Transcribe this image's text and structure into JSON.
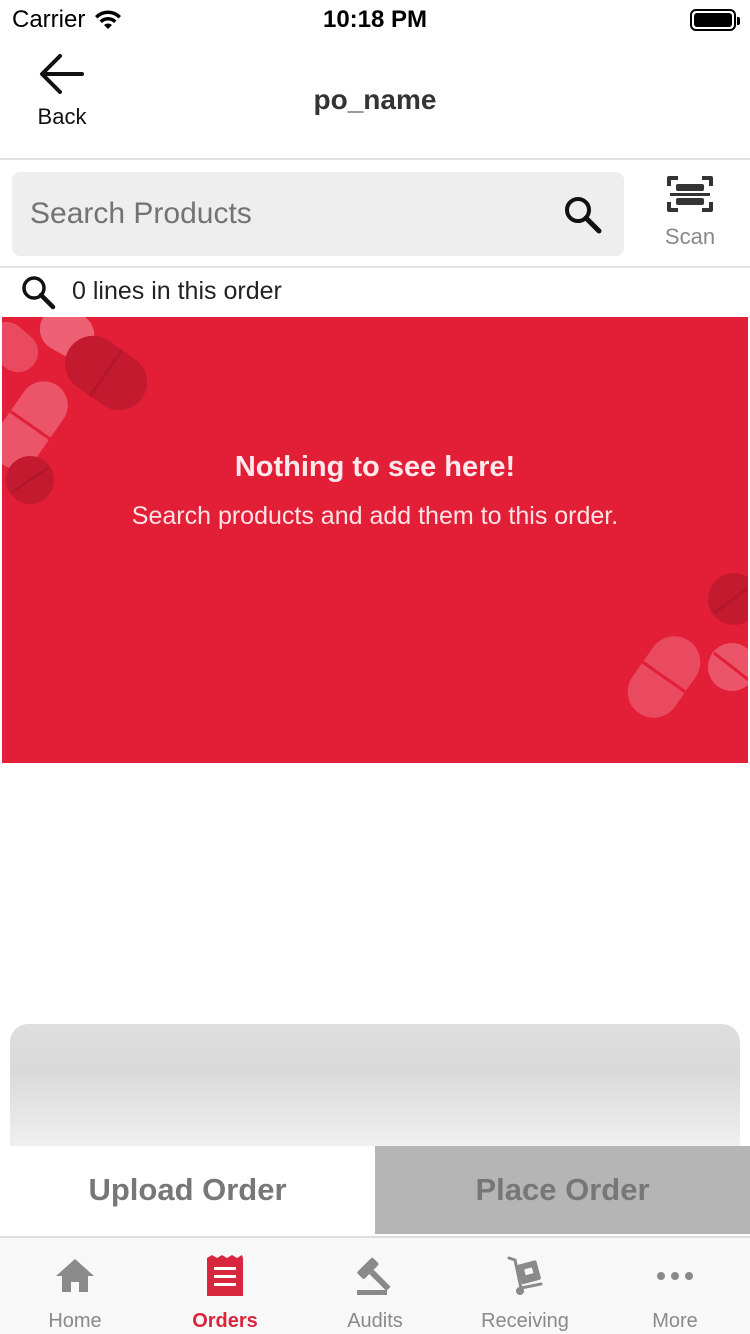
{
  "status_bar": {
    "carrier": "Carrier",
    "time": "10:18 PM"
  },
  "nav": {
    "back_label": "Back",
    "title": "po_name"
  },
  "search": {
    "placeholder": "Search Products",
    "value": "",
    "scan_label": "Scan"
  },
  "order_summary": {
    "lines_text": "0 lines in this order"
  },
  "empty_state": {
    "title": "Nothing to see here!",
    "subtitle": "Search products and add them to this order."
  },
  "actions": {
    "upload_label": "Upload Order",
    "place_label": "Place Order"
  },
  "tabs": [
    {
      "label": "Home",
      "icon": "home-icon",
      "active": false
    },
    {
      "label": "Orders",
      "icon": "orders-icon",
      "active": true
    },
    {
      "label": "Audits",
      "icon": "gavel-icon",
      "active": false
    },
    {
      "label": "Receiving",
      "icon": "hand-truck-icon",
      "active": false
    },
    {
      "label": "More",
      "icon": "more-dots-icon",
      "active": false
    }
  ],
  "colors": {
    "brand_red": "#e31e37",
    "active_tab": "#d7263d",
    "place_order_disabled": "#b5b5b5"
  }
}
